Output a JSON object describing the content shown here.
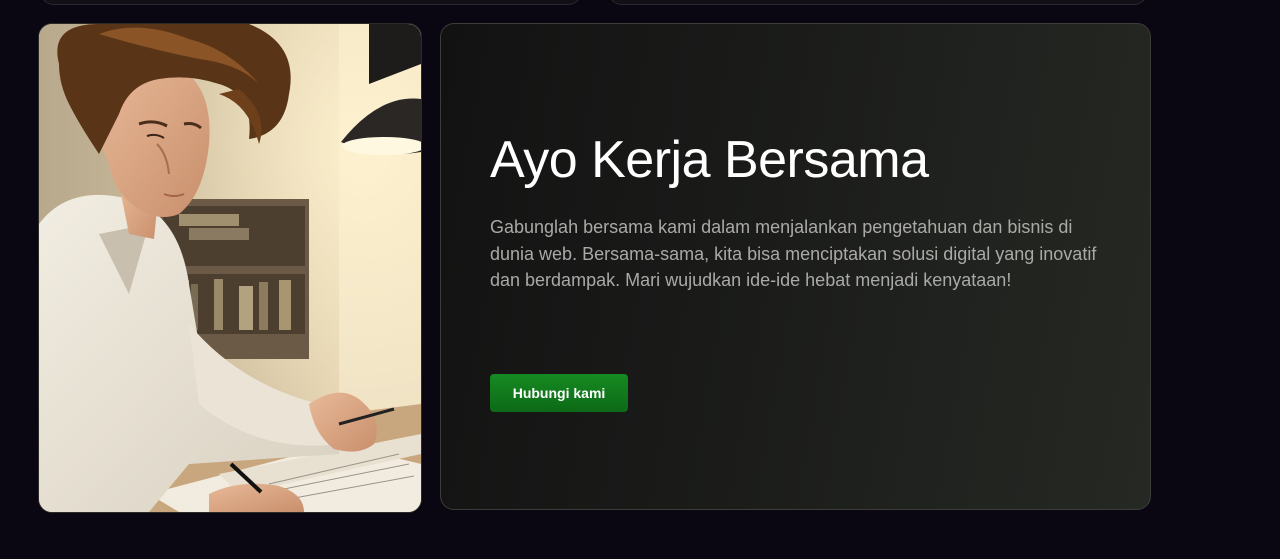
{
  "cta": {
    "title": "Ayo Kerja Bersama",
    "description": "Gabunglah bersama kami dalam menjalankan pengetahuan dan bisnis di dunia web. Bersama-sama, kita bisa menciptakan solusi digital yang inovatif dan berdampak. Mari wujudkan ide-ide hebat menjadi kenyataan!",
    "button_label": "Hubungi kami"
  },
  "colors": {
    "background": "#0a0612",
    "accent": "#168a22",
    "card": "#1a1b19"
  }
}
